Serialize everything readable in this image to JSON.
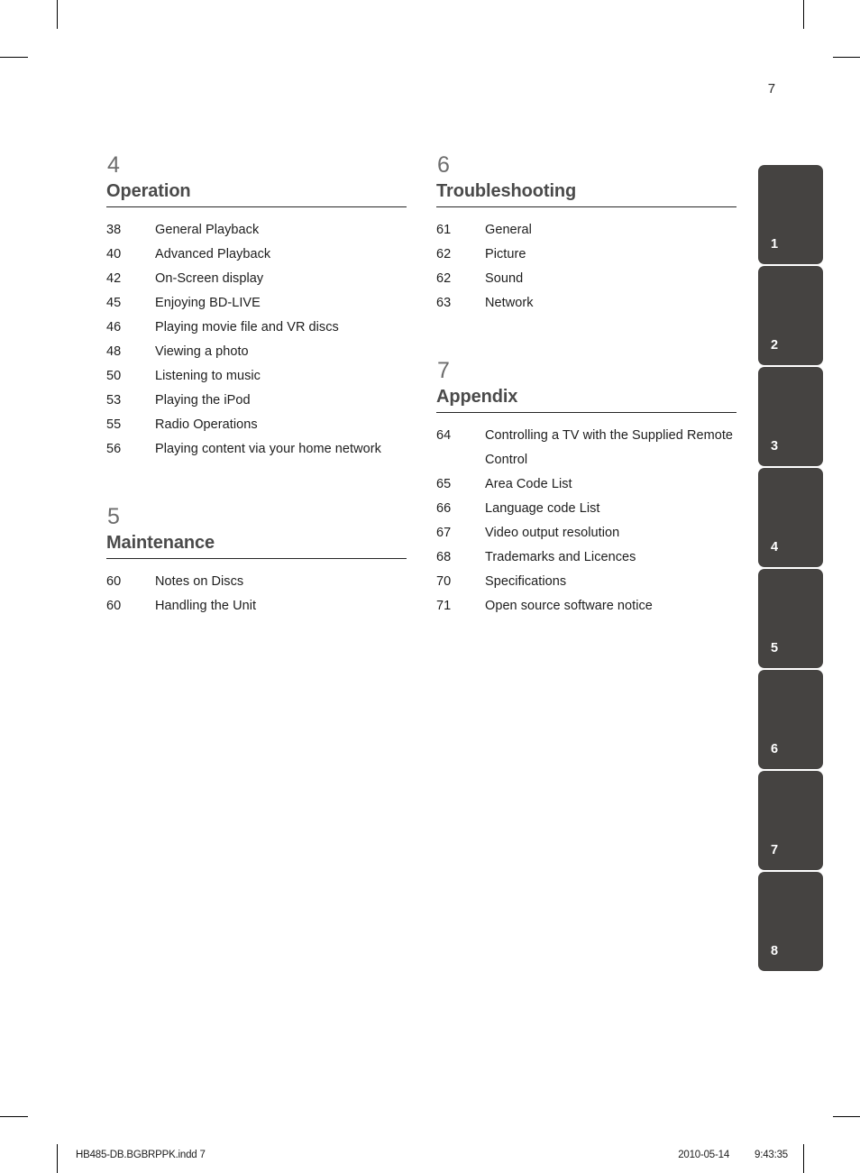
{
  "page": {
    "number": "7"
  },
  "columns": [
    {
      "sections": [
        {
          "number": "4",
          "title": "Operation",
          "entries": [
            {
              "page": "38",
              "title": "General Playback"
            },
            {
              "page": "40",
              "title": "Advanced Playback"
            },
            {
              "page": "42",
              "title": "On-Screen display"
            },
            {
              "page": "45",
              "title": "Enjoying BD-LIVE"
            },
            {
              "page": "46",
              "title": "Playing movie file and VR discs"
            },
            {
              "page": "48",
              "title": "Viewing a photo"
            },
            {
              "page": "50",
              "title": "Listening to music"
            },
            {
              "page": "53",
              "title": "Playing the iPod"
            },
            {
              "page": "55",
              "title": "Radio Operations"
            },
            {
              "page": "56",
              "title": "Playing content via your home network"
            }
          ]
        },
        {
          "number": "5",
          "title": "Maintenance",
          "entries": [
            {
              "page": "60",
              "title": "Notes on Discs"
            },
            {
              "page": "60",
              "title": "Handling the Unit"
            }
          ]
        }
      ]
    },
    {
      "sections": [
        {
          "number": "6",
          "title": "Troubleshooting",
          "entries": [
            {
              "page": "61",
              "title": "General"
            },
            {
              "page": "62",
              "title": "Picture"
            },
            {
              "page": "62",
              "title": "Sound"
            },
            {
              "page": "63",
              "title": "Network"
            }
          ]
        },
        {
          "number": "7",
          "title": "Appendix",
          "entries": [
            {
              "page": "64",
              "title": "Controlling a TV with the Supplied Remote Control"
            },
            {
              "page": "65",
              "title": "Area Code List"
            },
            {
              "page": "66",
              "title": "Language code List"
            },
            {
              "page": "67",
              "title": "Video output resolution"
            },
            {
              "page": "68",
              "title": "Trademarks and Licences"
            },
            {
              "page": "70",
              "title": "Specifications"
            },
            {
              "page": "71",
              "title": "Open source software notice"
            }
          ]
        }
      ]
    }
  ],
  "tab_strip": {
    "tabs": [
      "1",
      "2",
      "3",
      "4",
      "5",
      "6",
      "7",
      "8"
    ],
    "color": "#454341"
  },
  "footer": {
    "filename": "HB485-DB.BGBRPPK.indd   7",
    "date": "2010-05-14",
    "time": "9:43:35"
  }
}
